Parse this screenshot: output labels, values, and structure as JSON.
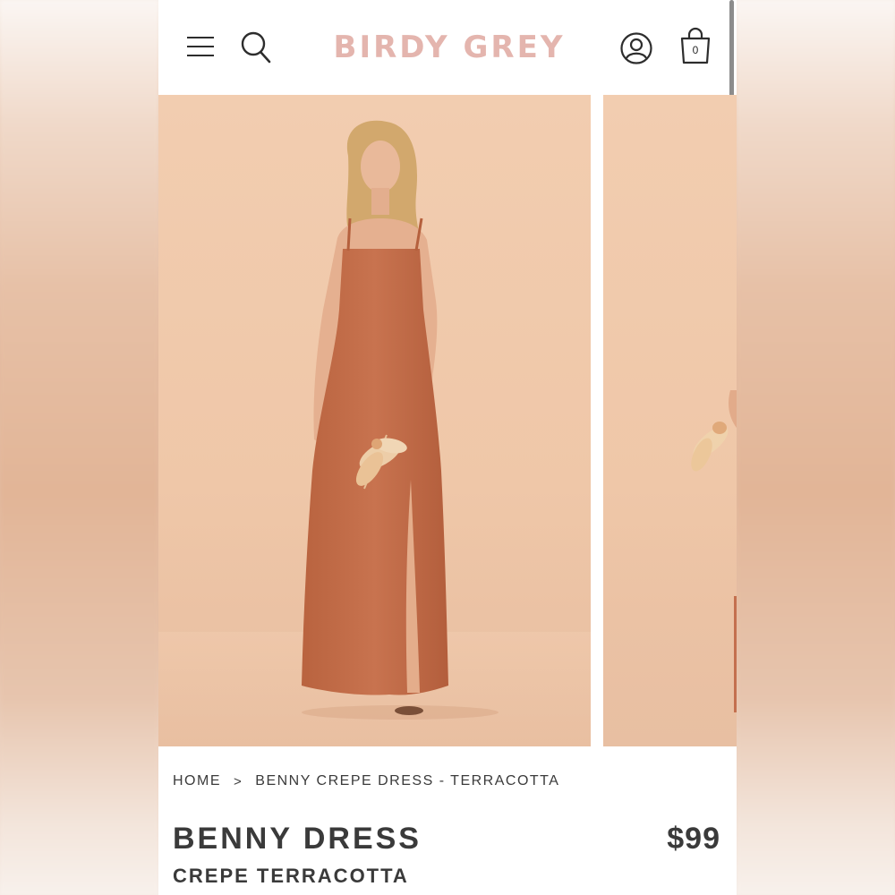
{
  "brand": {
    "logo_text": "BIRDY GREY",
    "logo_color": "#e4b5ae"
  },
  "header": {
    "icons": [
      "menu-icon",
      "search-icon",
      "account-icon",
      "shopping-bag-icon"
    ],
    "cart_count": "0"
  },
  "gallery": {
    "slides": [
      "product-photo-front",
      "product-photo-side"
    ],
    "background_color": "#f0c9ab",
    "dress_color": "#c4704f"
  },
  "breadcrumb": {
    "home": "HOME",
    "separator": ">",
    "current": "BENNY CREPE DRESS - TERRACOTTA"
  },
  "product": {
    "name": "BENNY DRESS",
    "variant": "CREPE TERRACOTTA",
    "price": "$99"
  }
}
